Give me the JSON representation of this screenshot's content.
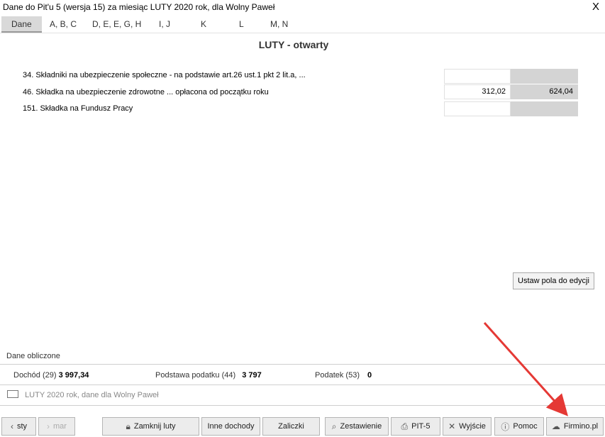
{
  "window": {
    "title": "Dane do Pit'u 5 (wersja 15) za miesiąc LUTY 2020 rok, dla Wolny Paweł",
    "close": "X"
  },
  "tabs": [
    {
      "label": "Dane"
    },
    {
      "label": "A, B, C"
    },
    {
      "label": "D, E, E, G, H"
    },
    {
      "label": "I, J"
    },
    {
      "label": "K"
    },
    {
      "label": "L"
    },
    {
      "label": "M, N"
    }
  ],
  "month_title": "LUTY - otwarty",
  "rows": [
    {
      "label": "34. Składniki na ubezpieczenie społeczne - na podstawie art.26 ust.1 pkt 2 lit.a, ...",
      "input": "",
      "calc": ""
    },
    {
      "label": "46. Składka na ubezpieczenie zdrowotne ... opłacona od początku roku",
      "input": "312,02",
      "calc": "624,04"
    },
    {
      "label": "151. Składka na Fundusz Pracy",
      "input": "",
      "calc": ""
    }
  ],
  "ustaw_button": "Ustaw pola do edycji",
  "dane_obliczone": "Dane obliczone",
  "summary": {
    "dochod_label": "Dochód (29)",
    "dochod_value": "3 997,34",
    "podstawa_label": "Podstawa podatku (44)",
    "podstawa_value": "3 797",
    "podatek_label": "Podatek (53)",
    "podatek_value": "0"
  },
  "info": "LUTY 2020 rok, dane dla Wolny Paweł",
  "buttons": {
    "prev": "sty",
    "next": "mar",
    "zamknij": "Zamknij luty",
    "inne": "Inne dochody",
    "zaliczki": "Zaliczki",
    "zestawienie": "Zestawienie",
    "pit5": "PIT-5",
    "wyjscie": "Wyjście",
    "pomoc": "Pomoc",
    "firmino": "Firmino.pl"
  },
  "colors": {
    "arrow": "#e53935",
    "calc_field": "#d4d4d4"
  }
}
